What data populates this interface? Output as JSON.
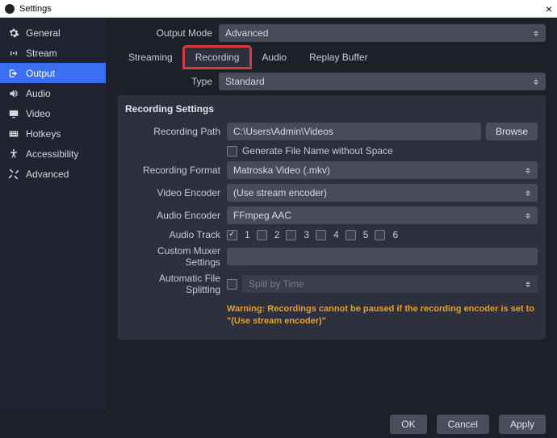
{
  "window": {
    "title": "Settings"
  },
  "sidebar": {
    "items": [
      {
        "label": "General"
      },
      {
        "label": "Stream"
      },
      {
        "label": "Output"
      },
      {
        "label": "Audio"
      },
      {
        "label": "Video"
      },
      {
        "label": "Hotkeys"
      },
      {
        "label": "Accessibility"
      },
      {
        "label": "Advanced"
      }
    ]
  },
  "output_mode": {
    "label": "Output Mode",
    "value": "Advanced"
  },
  "tabs": {
    "streaming": "Streaming",
    "recording": "Recording",
    "audio": "Audio",
    "replay_buffer": "Replay Buffer"
  },
  "type_row": {
    "label": "Type",
    "value": "Standard"
  },
  "recording": {
    "section_title": "Recording Settings",
    "path_label": "Recording Path",
    "path_value": "C:\\Users\\Admin\\Videos",
    "browse": "Browse",
    "gen_no_space": "Generate File Name without Space",
    "format_label": "Recording Format",
    "format_value": "Matroska Video (.mkv)",
    "venc_label": "Video Encoder",
    "venc_value": "(Use stream encoder)",
    "aenc_label": "Audio Encoder",
    "aenc_value": "FFmpeg AAC",
    "track_label": "Audio Track",
    "tracks": [
      "1",
      "2",
      "3",
      "4",
      "5",
      "6"
    ],
    "muxer_label": "Custom Muxer Settings",
    "muxer_value": "",
    "split_label": "Automatic File Splitting",
    "split_value": "Split by Time",
    "warning": "Warning: Recordings cannot be paused if the recording encoder is set to \"(Use stream encoder)\""
  },
  "footer": {
    "ok": "OK",
    "cancel": "Cancel",
    "apply": "Apply"
  }
}
